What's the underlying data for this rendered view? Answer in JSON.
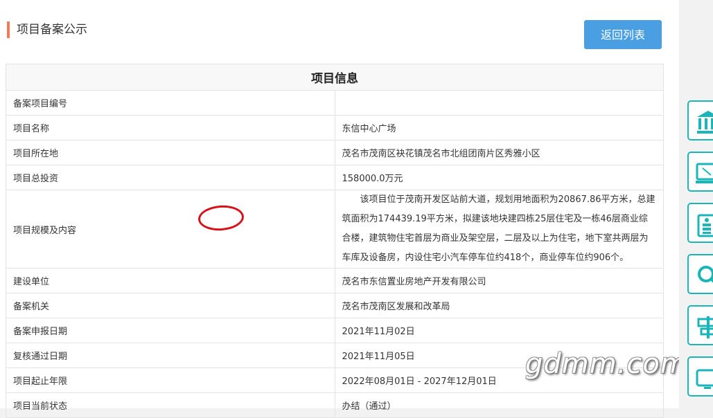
{
  "header": {
    "section_title": "项目备案公示",
    "back_button": "返回列表"
  },
  "table": {
    "heading": "项目信息",
    "rows": [
      {
        "label": "备案项目编号",
        "value": ""
      },
      {
        "label": "项目名称",
        "value": "东信中心广场"
      },
      {
        "label": "项目所在地",
        "value": "茂名市茂南区袂花镇茂名市北组团南片区秀雅小区"
      },
      {
        "label": "项目总投资",
        "value": "158000.0万元"
      },
      {
        "label": "项目规模及内容",
        "value": "该项目位于茂南开发区站前大道，规划用地面积为20867.86平方米，总建筑面积为174439.19平方米，拟建该地块建四栋25层住宅及一栋46层商业综合楼，建筑物住宅首层为商业及架空层，二层及以上为住宅，地下室共两层为车库及设备房，内设住宅小汽车停车位约418个，商业停车位约906个。"
      },
      {
        "label": "建设单位",
        "value": "茂名市东信置业房地产开发有限公司"
      },
      {
        "label": "备案机关",
        "value": "茂名市茂南区发展和改革局"
      },
      {
        "label": "备案申报日期",
        "value": "2021年11月02日"
      },
      {
        "label": "复核通过日期",
        "value": "2021年11月05日"
      },
      {
        "label": "项目起止年限",
        "value": "2022年08月01日 - 2027年12月01日"
      },
      {
        "label": "项目当前状态",
        "value": "办结（通过）"
      }
    ]
  },
  "annotation": {
    "color": "#d9121a"
  },
  "watermark": "gdmm.com",
  "sidebar": {
    "accent": "#19b5b8",
    "icons": [
      "bank-icon",
      "computer-icon",
      "document-stack-icon",
      "search-icon",
      "signpost-icon",
      "monitor-icon"
    ]
  }
}
